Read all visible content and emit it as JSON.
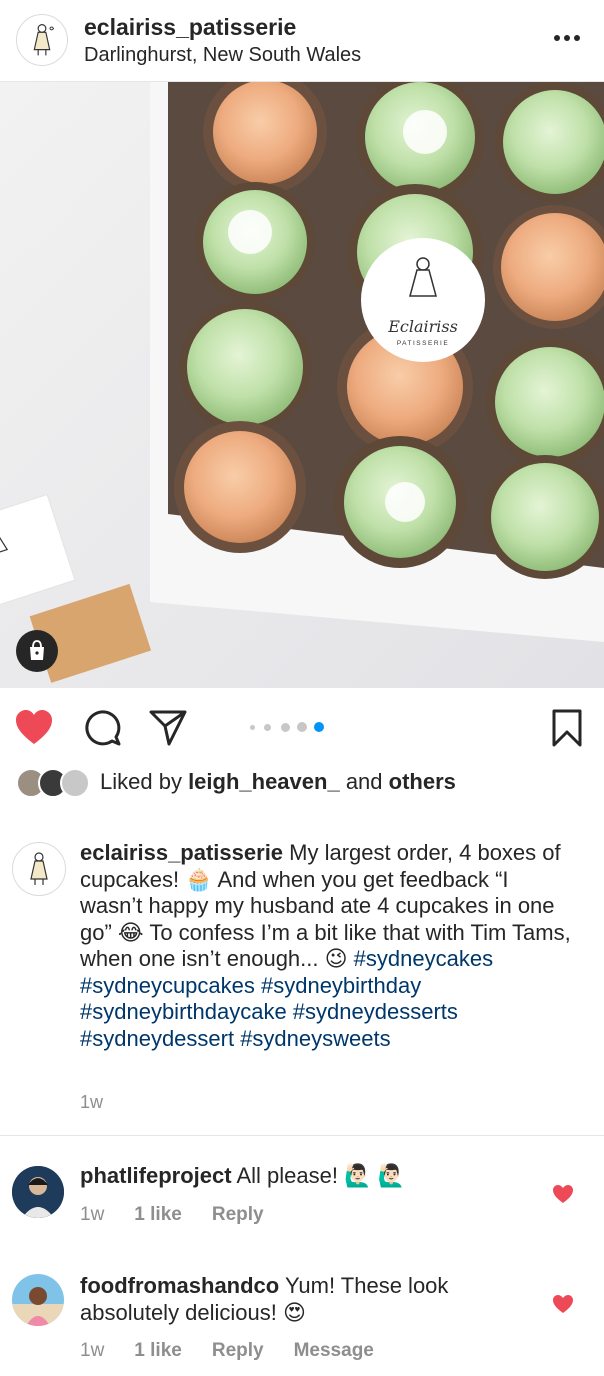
{
  "post": {
    "username": "eclairiss_patisserie",
    "location": "Darlinghurst, New South Wales",
    "photo_brand_text": "Eclairiss",
    "photo_brand_subtext": "PATISSERIE",
    "liked_prefix": "Liked by ",
    "liked_user": "leigh_heaven_",
    "liked_and": " and ",
    "liked_others": "others",
    "carousel": {
      "total": 4,
      "active_index": 4
    },
    "liked_by_viewer": true
  },
  "caption": {
    "username": "eclairiss_patisserie",
    "text": " My largest order, 4 boxes of cupcakes! 🧁 And when you get feedback “I wasn’t happy my husband ate 4 cupcakes in one go” 😂 To confess I’m a bit like that with Tim Tams, when one isn’t enough... 😉 ",
    "hashtags": "#sydneycakes #sydneycupcakes #sydneybirthday #sydneybirthdaycake #sydneydesserts #sydneydessert #sydneysweets",
    "time": "1w"
  },
  "comments": [
    {
      "username": "phatlifeproject",
      "text": " All please! 🙋🏻‍♂️ 🙋🏻‍♂️",
      "time": "1w",
      "likes": "1 like",
      "reply": "Reply"
    },
    {
      "username": "foodfromashandco",
      "text": " Yum! These look absolutely delicious! 😍",
      "time": "1w",
      "likes": "1 like",
      "reply": "Reply",
      "message": "Message"
    }
  ],
  "colors": {
    "heart": "#ed4956",
    "hashtag": "#00376b",
    "muted": "#8e8e8e",
    "active_dot": "#0095f6",
    "frosting_green": "#bfe0a8",
    "frosting_peach": "#f2b48a"
  },
  "icons": {
    "more": "more-options-icon",
    "like": "heart-icon",
    "comment": "comment-icon",
    "share": "send-icon",
    "save": "bookmark-icon",
    "shop": "shopping-bag-icon"
  }
}
